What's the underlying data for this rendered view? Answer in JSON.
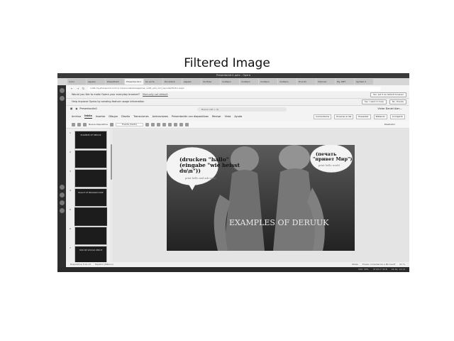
{
  "figure": {
    "title": "Filtered Image"
  },
  "window_title": "Presentación1.pptx - Opera",
  "browser": {
    "tabs": [
      {
        "label": "Inicio"
      },
      {
        "label": "alguien"
      },
      {
        "label": "PowerPoint"
      },
      {
        "label": "Presentación1"
      },
      {
        "label": "Un archi"
      },
      {
        "label": "Duckduck"
      },
      {
        "label": "alguien"
      },
      {
        "label": "YouTube"
      },
      {
        "label": "multipro"
      },
      {
        "label": "multipro"
      },
      {
        "label": "multipro"
      },
      {
        "label": "multipro"
      },
      {
        "label": "El archi"
      },
      {
        "label": "Internet"
      },
      {
        "label": "My .NET"
      },
      {
        "label": "Symbol 2"
      }
    ],
    "url": "outlk-my.sharepoint.com/:p:/r/personal/alanagamez_outlk_edu_mx/_layouts/15/doc.aspx",
    "default_prompt": {
      "text": "Would you like to make Opera your everyday browser?",
      "link": "Manually set default",
      "button": "Yes, set it as default browser"
    },
    "improve_prompt": {
      "text": "Help improve Opera by sending feature usage information",
      "accept": "Yes, I want to help",
      "decline": "No, thanks"
    }
  },
  "office": {
    "file_name": "Presentación1",
    "search_placeholder": "Buscar (Alt + Q)",
    "user": "Victor Daniel Alan...",
    "ribbon_tabs": [
      "Archivo",
      "Inicio",
      "Insertar",
      "Dibujar",
      "Diseño",
      "Transiciones",
      "Animaciones",
      "Presentación con diapositivas",
      "Revisar",
      "Vista",
      "Ayuda"
    ],
    "ribbon_actions": [
      "Comentarios",
      "Ponerse al día",
      "Presentar",
      "Editando",
      "Compartir"
    ],
    "new_slide_label": "Nueva diapositiva",
    "font_placeholder": "Fuente (texto)",
    "designer_label": "Diseñador",
    "slides": [
      {
        "num": "1",
        "text": "EXAMPLES OF DERUUK"
      },
      {
        "num": "2",
        "text": ""
      },
      {
        "num": "3",
        "text": ""
      },
      {
        "num": "4",
        "text": "BALLOT OF PROGRAM CODE"
      },
      {
        "num": "5",
        "text": ""
      },
      {
        "num": "6",
        "text": ""
      },
      {
        "num": "7",
        "text": "HOW WE SHOULD DERIVE"
      }
    ],
    "current_slide": {
      "bubble_left_lines": [
        "(drucken \"hallo\"",
        "(eingabe \"wie heisst",
        "du\\n\"))"
      ],
      "bubble_left_small": "print hello and ask name",
      "bubble_right_lines": [
        "(печать",
        "\"привет Мир\")"
      ],
      "bubble_right_small": "print hello world",
      "caption": "EXAMPLES OF DERUUK"
    },
    "status": {
      "slide_info": "Diapositiva 5 de 13",
      "language": "Español (México)",
      "notes": "Notas",
      "feedback": "Enviar comentarios a Microsoft",
      "zoom": "61 %"
    }
  },
  "system_tray": {
    "cpu": "CPU: 30%",
    "temp": "37.9% F 43 B",
    "clock": "24 Ab, 14:13"
  }
}
